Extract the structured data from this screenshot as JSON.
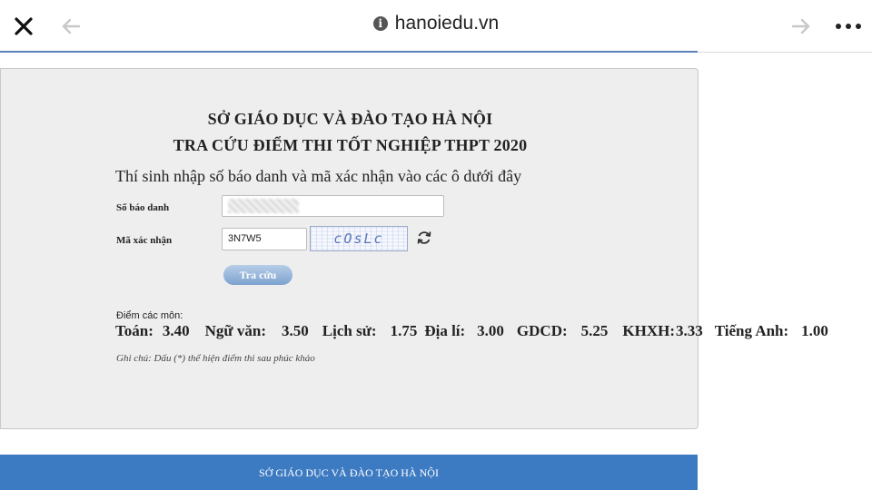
{
  "browser": {
    "url": "hanoiedu.vn"
  },
  "page": {
    "title_line1": "SỞ GIÁO DỤC VÀ ĐÀO TẠO HÀ NỘI",
    "title_line2": "TRA CỨU ĐIỂM THI TỐT NGHIỆP THPT 2020",
    "instruction": "Thí sinh nhập số báo danh và mã xác nhận vào các ô dưới đây",
    "form": {
      "sbd_label": "Số báo danh",
      "sbd_value": "",
      "captcha_label": "Mã xác nhận",
      "captcha_value": "3N7W5",
      "captcha_image_text": "cOsLc",
      "submit_label": "Tra cứu"
    },
    "results": {
      "label": "Điểm các môn:",
      "scores": [
        {
          "subject": "Toán:",
          "score": "3.40"
        },
        {
          "subject": "Ngữ văn:",
          "score": "3.50"
        },
        {
          "subject": "Lịch sử:",
          "score": "1.75"
        },
        {
          "subject": "Địa lí:",
          "score": "3.00"
        },
        {
          "subject": "GDCD:",
          "score": "5.25"
        },
        {
          "subject": "KHXH:",
          "score": "3.33"
        },
        {
          "subject": "Tiếng Anh:",
          "score": "1.00"
        }
      ],
      "note": "Ghi chú: Dấu (*) thể hiện điểm thi sau phúc khảo"
    }
  },
  "footer": {
    "text": "SỞ GIÁO DỤC VÀ ĐÀO TẠO HÀ NỘI"
  },
  "colors": {
    "footer_bg": "#3c7ac2",
    "panel_bg": "#eeeeee",
    "button_bg": "#7da2cf",
    "progress": "#5b82b8"
  }
}
